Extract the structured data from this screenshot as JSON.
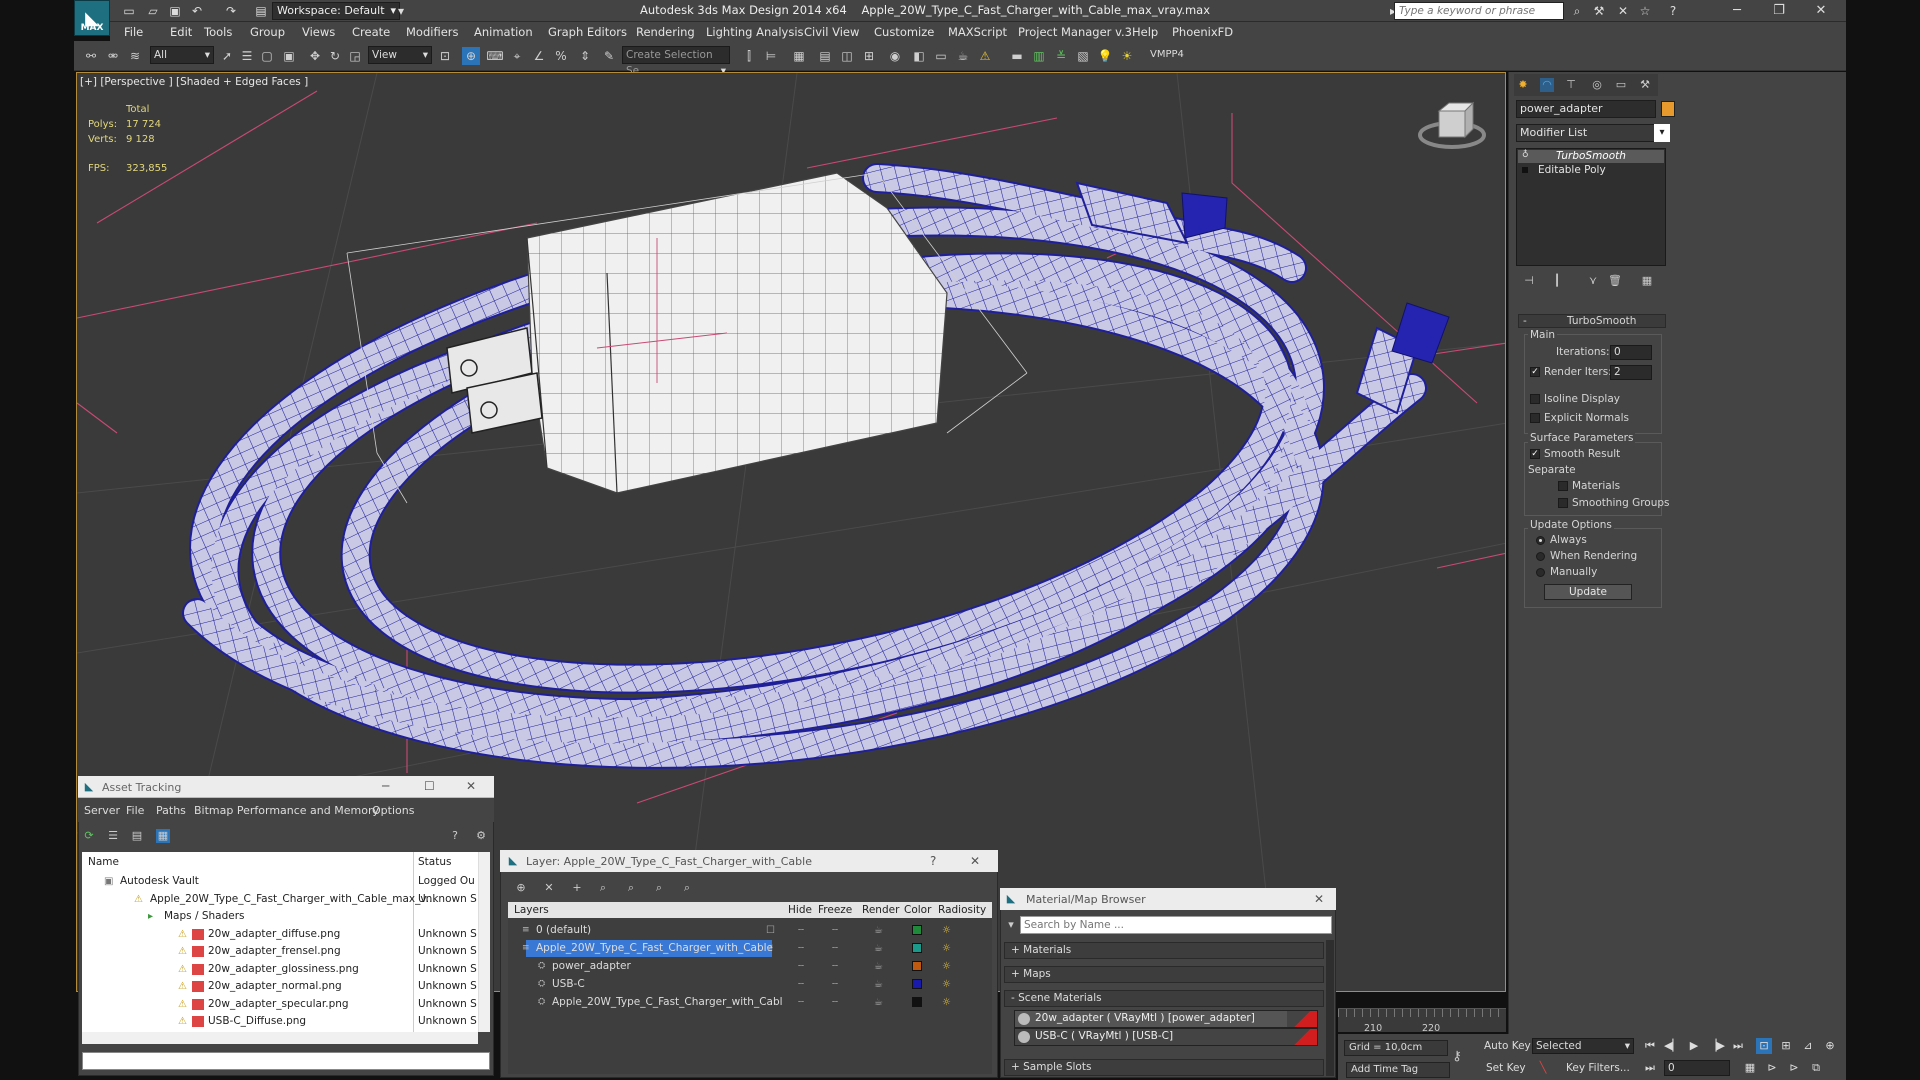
{
  "window": {
    "workspace": "Workspace: Default",
    "app_name": "Autodesk 3ds Max Design 2014 x64",
    "file_name": "Apple_20W_Type_C_Fast_Charger_with_Cable_max_vray.max",
    "search_placeholder": "Type a keyword or phrase",
    "logo_text": "MAX"
  },
  "menu": [
    "File",
    "Edit",
    "Tools",
    "Group",
    "Views",
    "Create",
    "Modifiers",
    "Animation",
    "Graph Editors",
    "Rendering",
    "Lighting Analysis",
    "Civil View",
    "Customize",
    "MAXScript",
    "Project Manager v.3",
    "Help",
    "PhoenixFD"
  ],
  "toolbar": {
    "filter": "All",
    "ref_coord": "View",
    "selection_set": "Create Selection Se",
    "vmpp": "VMPP4"
  },
  "viewport": {
    "label": "[+] [Perspective ] [Shaded + Edged Faces ]",
    "stats": {
      "total_label": "Total",
      "polys_label": "Polys:",
      "polys": "17 724",
      "verts_label": "Verts:",
      "verts": "9 128",
      "fps_label": "FPS:",
      "fps": "323,855"
    }
  },
  "command_panel": {
    "object_name": "power_adapter",
    "modifier_list": "Modifier List",
    "stack": [
      "TurboSmooth",
      "Editable Poly"
    ],
    "turbosmooth": {
      "title": "TurboSmooth",
      "main": "Main",
      "iterations_label": "Iterations:",
      "iterations": "0",
      "render_iters_label": "Render Iters:",
      "render_iters": "2",
      "isoline": "Isoline Display",
      "explicit_normals": "Explicit Normals",
      "surface_params": "Surface Parameters",
      "smooth_result": "Smooth Result",
      "separate": "Separate",
      "materials": "Materials",
      "smoothing_groups": "Smoothing Groups",
      "update_options": "Update Options",
      "always": "Always",
      "when_rendering": "When Rendering",
      "manually": "Manually",
      "update_button": "Update"
    }
  },
  "asset_tracking": {
    "title": "Asset Tracking",
    "menu": [
      "Server",
      "File",
      "Paths",
      "Bitmap Performance and Memory",
      "Options"
    ],
    "col_name": "Name",
    "col_status": "Status",
    "rows": [
      {
        "name": "Autodesk Vault",
        "status": "Logged Ou"
      },
      {
        "name": "Apple_20W_Type_C_Fast_Charger_with_Cable_max_v...",
        "status": "Unknown S"
      },
      {
        "name": "Maps / Shaders",
        "status": ""
      },
      {
        "name": "20w_adapter_diffuse.png",
        "status": "Unknown S"
      },
      {
        "name": "20w_adapter_frensel.png",
        "status": "Unknown S"
      },
      {
        "name": "20w_adapter_glossiness.png",
        "status": "Unknown S"
      },
      {
        "name": "20w_adapter_normal.png",
        "status": "Unknown S"
      },
      {
        "name": "20w_adapter_specular.png",
        "status": "Unknown S"
      },
      {
        "name": "USB-C_Diffuse.png",
        "status": "Unknown S"
      }
    ]
  },
  "layer_dialog": {
    "title": "Layer: Apple_20W_Type_C_Fast_Charger_with_Cable",
    "help": "?",
    "columns": [
      "Layers",
      "Hide",
      "Freeze",
      "Render",
      "Color",
      "Radiosity"
    ],
    "rows": [
      {
        "name": "0 (default)",
        "color": "#1f8a3a"
      },
      {
        "name": "Apple_20W_Type_C_Fast_Charger_with_Cable",
        "color": "#1a9a8a"
      },
      {
        "name": "power_adapter",
        "color": "#c05a10"
      },
      {
        "name": "USB-C",
        "color": "#1a1aaa"
      },
      {
        "name": "Apple_20W_Type_C_Fast_Charger_with_Cabl",
        "color": "#111111"
      }
    ]
  },
  "material_browser": {
    "title": "Material/Map Browser",
    "search_placeholder": "Search by Name ...",
    "sections": [
      "+ Materials",
      "+ Maps",
      "- Scene Materials"
    ],
    "materials": [
      "20w_adapter  ( VRayMtl )  [power_adapter]",
      "USB-C  ( VRayMtl )  [USB-C]"
    ],
    "sample_slots": "+ Sample Slots"
  },
  "status": {
    "grid": "Grid = 10,0cm",
    "add_time_tag": "Add Time Tag",
    "auto_key": "Auto Key",
    "set_key": "Set Key",
    "selected": "Selected",
    "key_filters": "Key Filters...",
    "frame": "0",
    "ticks": [
      "210",
      "220"
    ]
  },
  "colors": {
    "accent": "#1e6f80",
    "selection": "#3a78d6",
    "viewport_border": "#b38b3a",
    "wire": "#1f1f9a"
  }
}
